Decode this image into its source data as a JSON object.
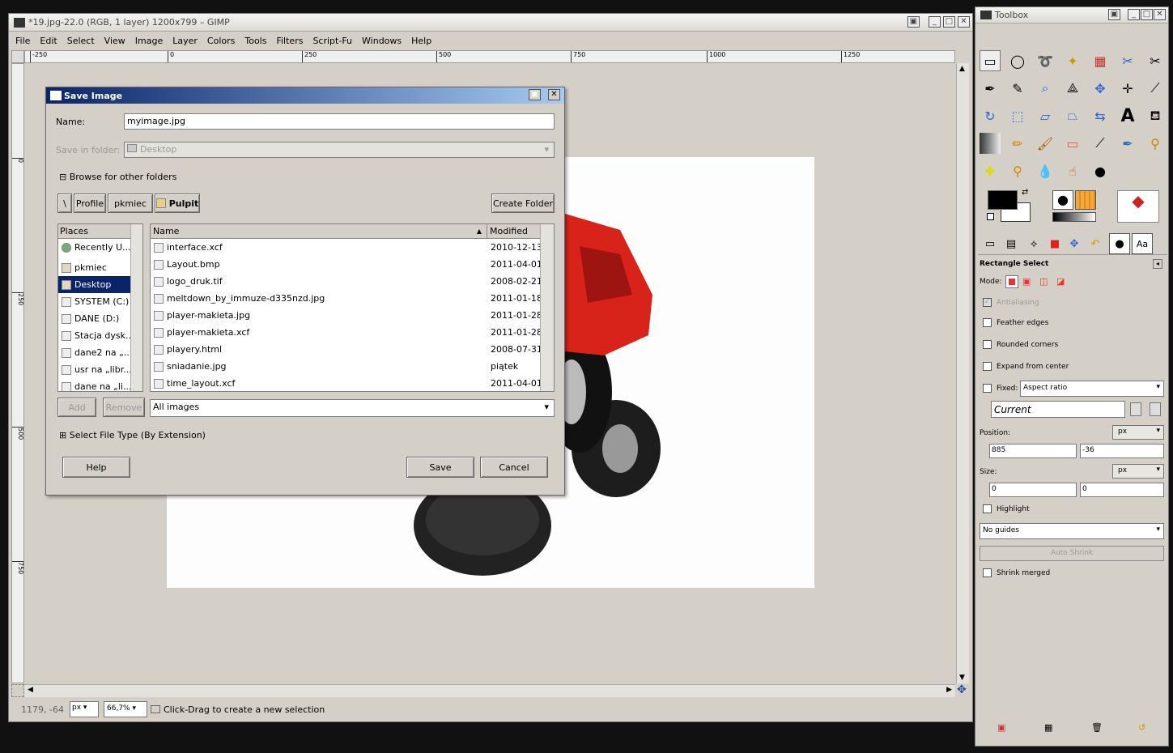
{
  "main": {
    "title": "*19.jpg-22.0 (RGB, 1 layer) 1200x799 – GIMP",
    "menu": [
      "File",
      "Edit",
      "Select",
      "View",
      "Image",
      "Layer",
      "Colors",
      "Tools",
      "Filters",
      "Script-Fu",
      "Windows",
      "Help"
    ],
    "ruler_h": [
      "-250",
      "0",
      "250",
      "500",
      "750",
      "1000",
      "1250"
    ],
    "ruler_v": [
      "0",
      "250",
      "500",
      "750"
    ],
    "status": {
      "coords": "1179, -64",
      "unit": "px",
      "zoom": "66,7%",
      "message": "Click-Drag to create a new selection"
    }
  },
  "dialog": {
    "title": "Save Image",
    "name_label": "Name:",
    "name_value": "myimage.jpg",
    "folder_label": "Save in folder:",
    "folder_value": "Desktop",
    "browse_label": "Browse for other folders",
    "path": [
      "\\",
      "Profile",
      "pkmiec",
      "Pulpit"
    ],
    "create_folder": "Create Folder",
    "places_header": "Places",
    "places": [
      "Recently U...",
      "pkmiec",
      "Desktop",
      "SYSTEM (C:)",
      "DANE (D:)",
      "Stacja dysk...",
      "dane2 na „...",
      "usr na „libr...",
      "dane na „li..."
    ],
    "places_selected": "Desktop",
    "col_name": "Name",
    "col_modified": "Modified",
    "files": [
      {
        "name": "interface.xcf",
        "modified": "2010-12-13"
      },
      {
        "name": "Layout.bmp",
        "modified": "2011-04-01"
      },
      {
        "name": "logo_druk.tif",
        "modified": "2008-02-21"
      },
      {
        "name": "meltdown_by_immuze-d335nzd.jpg",
        "modified": "2011-01-18"
      },
      {
        "name": "player-makieta.jpg",
        "modified": "2011-01-28"
      },
      {
        "name": "player-makieta.xcf",
        "modified": "2011-01-28"
      },
      {
        "name": "playery.html",
        "modified": "2008-07-31"
      },
      {
        "name": "sniadanie.jpg",
        "modified": "piątek"
      },
      {
        "name": "time_layout.xcf",
        "modified": "2011-04-01"
      }
    ],
    "add": "Add",
    "remove": "Remove",
    "filter": "All images",
    "file_type": "Select File Type (By Extension)",
    "help": "Help",
    "save": "Save",
    "cancel": "Cancel"
  },
  "toolbox": {
    "title": "Toolbox",
    "tool_name": "Rectangle Select",
    "mode_label": "Mode:",
    "antialiasing": "Antialiasing",
    "feather": "Feather edges",
    "rounded": "Rounded corners",
    "expand": "Expand from center",
    "fixed": "Fixed:",
    "fixed_value": "Aspect ratio",
    "current": "Current",
    "position_label": "Position:",
    "pos_unit": "px",
    "pos_x": "885",
    "pos_y": "-36",
    "size_label": "Size:",
    "size_unit": "px",
    "size_w": "0",
    "size_h": "0",
    "highlight": "Highlight",
    "guides": "No guides",
    "auto_shrink": "Auto Shrink",
    "shrink_merged": "Shrink merged"
  }
}
